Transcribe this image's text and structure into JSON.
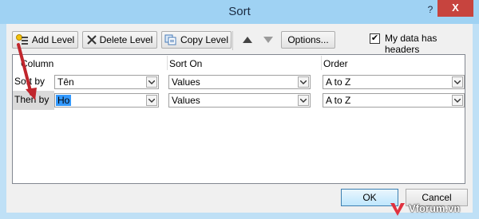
{
  "window": {
    "title": "Sort",
    "help_label": "?",
    "close_label": "X"
  },
  "toolbar": {
    "add_level": "Add Level",
    "delete_level": "Delete Level",
    "copy_level": "Copy Level",
    "options": "Options...",
    "my_data_has_headers": "My data has headers",
    "headers_checked": true
  },
  "grid": {
    "headers": {
      "column": "Column",
      "sort_on": "Sort On",
      "order": "Order"
    },
    "rows": [
      {
        "label": "Sort by",
        "column": "Tên",
        "sort_on": "Values",
        "order": "A to Z",
        "selected": false
      },
      {
        "label": "Then by",
        "column": "Ho",
        "sort_on": "Values",
        "order": "A to Z",
        "selected": true
      }
    ]
  },
  "footer": {
    "ok": "OK",
    "cancel": "Cancel"
  },
  "watermark": {
    "text": "Vforum.vn"
  },
  "colors": {
    "close": "#c7443e",
    "selection": "#3399ff",
    "annotation": "#c0262d"
  }
}
